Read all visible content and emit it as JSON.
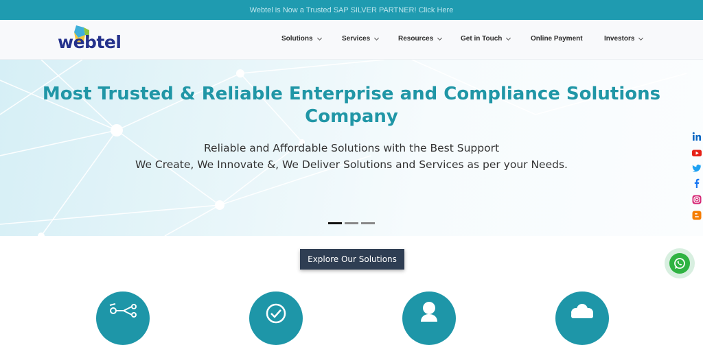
{
  "announcement": {
    "text": "Webtel is Now a Trusted SAP SILVER PARTNER! Click Here"
  },
  "logo": {
    "text": "webtel"
  },
  "nav": {
    "items": [
      {
        "label": "Solutions",
        "dropdown": true
      },
      {
        "label": "Services",
        "dropdown": true
      },
      {
        "label": "Resources",
        "dropdown": true
      },
      {
        "label": "Get in Touch",
        "dropdown": true
      },
      {
        "label": "Online Payment",
        "dropdown": false
      },
      {
        "label": "Investors",
        "dropdown": true
      }
    ]
  },
  "hero": {
    "title_line1": "Most Trusted & Reliable Enterprise and Compliance Solutions",
    "title_line2": "Company",
    "subtitle_line1": "Reliable and Affordable Solutions with the Best Support",
    "subtitle_line2": "We Create, We Innovate &, We Deliver Solutions and Services as per your Needs.",
    "slides": 3,
    "active_slide": 1
  },
  "social": [
    "linkedin-icon",
    "youtube-icon",
    "twitter-icon",
    "facebook-icon",
    "instagram-icon",
    "blogger-icon"
  ],
  "cta": {
    "explore_label": "Explore Our Solutions"
  },
  "features": [
    "integration-icon",
    "checkmark-icon",
    "user-icon",
    "cloud-icon"
  ],
  "colors": {
    "teal": "#1f9bb0",
    "title": "#2096a6",
    "navy": "#2f3e53",
    "whatsapp": "#2fb342"
  }
}
